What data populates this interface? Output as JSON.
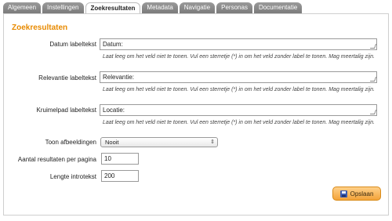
{
  "tabs": [
    {
      "label": "Algemeen",
      "active": false
    },
    {
      "label": "Instellingen",
      "active": false
    },
    {
      "label": "Zoekresultaten",
      "active": true
    },
    {
      "label": "Metadata",
      "active": false
    },
    {
      "label": "Navigatie",
      "active": false
    },
    {
      "label": "Personas",
      "active": false
    },
    {
      "label": "Documentatie",
      "active": false
    }
  ],
  "section_title": "Zoekresultaten",
  "fields": {
    "datum": {
      "label": "Datum labeltekst",
      "value": "Datum:",
      "help": "Laat leeg om het veld niet te tonen. Vul een sterretje (*) in om het veld zonder label te tonen. Mag meertalig zijn."
    },
    "relevantie": {
      "label": "Relevantie labeltekst",
      "value": "Relevantie:",
      "help": "Laat leeg om het veld niet te tonen. Vul een sterretje (*) in om het veld zonder label te tonen. Mag meertalig zijn."
    },
    "kruimelpad": {
      "label": "Kruimelpad labeltekst",
      "value": "Locatie:",
      "help": "Laat leeg om het veld niet te tonen. Vul een sterretje (*) in om het veld zonder label te tonen. Mag meertalig zijn."
    },
    "afbeeldingen": {
      "label": "Toon afbeeldingen",
      "value": "Nooit"
    },
    "aantal": {
      "label": "Aantal resultaten per pagina",
      "value": "10"
    },
    "lengte": {
      "label": "Lengte introtekst",
      "value": "200"
    }
  },
  "save_label": "Opslaan",
  "colors": {
    "accent": "#e88a00",
    "button": "#f3a33a",
    "tab": "#8a8a8a"
  },
  "icons": {
    "save": "disk-icon",
    "select": "chevron-updown-icon",
    "resize": "resize-grip-icon"
  }
}
